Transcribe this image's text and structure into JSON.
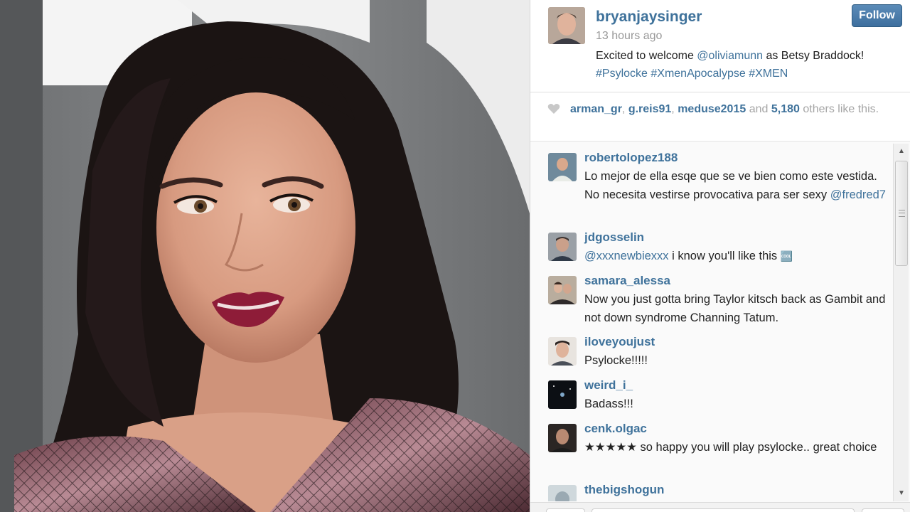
{
  "post": {
    "owner": "bryanjaysinger",
    "time": "13 hours ago",
    "caption_text": "Excited to welcome ",
    "caption_mention": "@oliviamunn",
    "caption_text_2": " as Betsy Braddock!",
    "hashtags": "#Psylocke #XmenApocalypse #XMEN",
    "follow_label": "Follow"
  },
  "likes": {
    "user1": "arman_gr",
    "user2": "g.reis91",
    "user3": "meduse2015",
    "joiner": "and",
    "count": "5,180",
    "suffix": "others like this."
  },
  "comments": [
    {
      "user": "robertolopez188",
      "text": "Lo mejor de ella esqe que se ve bien como este vestida. No necesita vestirse provocativa para ser sexy ",
      "mention": "@fredred7"
    },
    {
      "user": "jdgosselin",
      "mention": "@xxxnewbiexxx",
      "text": " i know you'll like this ",
      "emoji": "🆒"
    },
    {
      "user": "samara_alessa",
      "text": "Now you just gotta bring Taylor kitsch back as Gambit and not down syndrome Channing Tatum."
    },
    {
      "user": "iloveyoujust",
      "text": "Psylocke!!!!!"
    },
    {
      "user": "weird_i_",
      "text": "Badass!!!"
    },
    {
      "user": "cenk.olgac",
      "text": "★★★★★ so happy you will play psylocke.. great choice"
    },
    {
      "user": "thebigshogun",
      "text": ""
    }
  ],
  "colors": {
    "link": "#3f729b",
    "follow_button": "#3e6f9e",
    "muted": "#999999"
  },
  "icons": {
    "like": "heart-icon",
    "scroll_up": "arrow-up-icon",
    "scroll_down": "arrow-down-icon"
  }
}
